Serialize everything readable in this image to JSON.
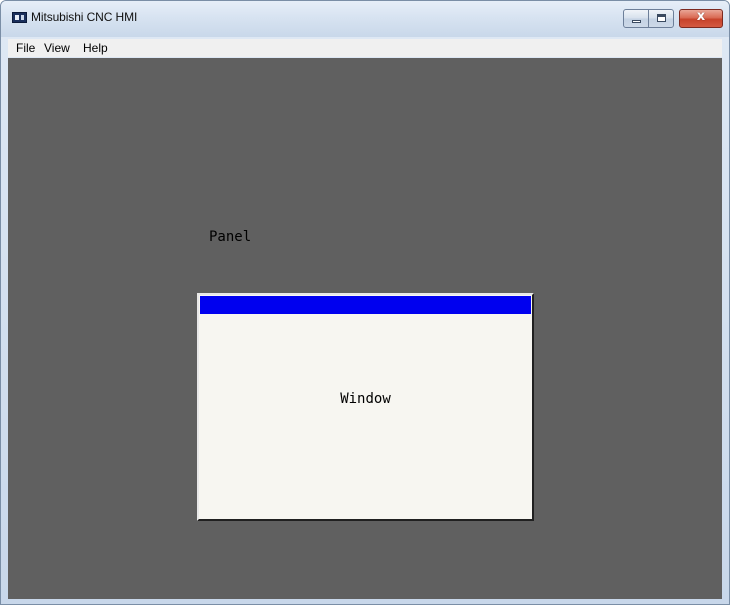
{
  "window": {
    "title": "Mitsubishi CNC HMI",
    "close_glyph": "x"
  },
  "menu": {
    "items": [
      {
        "label": "File"
      },
      {
        "label": "View"
      },
      {
        "label": "Help"
      }
    ]
  },
  "client": {
    "background_color": "#606060",
    "panel_label": "Panel",
    "sub_window": {
      "label": "Window",
      "titlebar_color": "#0000ef",
      "body_color": "#f7f6f1"
    }
  },
  "icons": {
    "app": "app-icon",
    "minimize": "minimize-icon",
    "maximize": "maximize-icon",
    "close": "close-icon"
  }
}
